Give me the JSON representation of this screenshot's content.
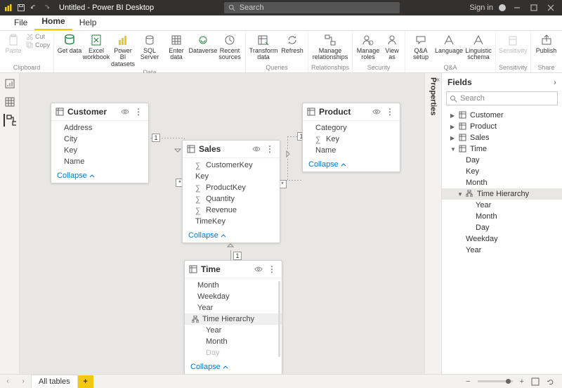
{
  "titlebar": {
    "title": "Untitled - Power BI Desktop",
    "search_placeholder": "Search",
    "signin": "Sign in"
  },
  "menu": {
    "file": "File",
    "home": "Home",
    "help": "Help"
  },
  "ribbon": {
    "clipboard": {
      "label": "Clipboard",
      "paste": "Paste",
      "cut": "Cut",
      "copy": "Copy"
    },
    "data": {
      "label": "Data",
      "get": "Get data",
      "excel": "Excel workbook",
      "pbids": "Power BI datasets",
      "sql": "SQL Server",
      "enter": "Enter data",
      "dataverse": "Dataverse",
      "recent": "Recent sources"
    },
    "queries": {
      "label": "Queries",
      "transform": "Transform data",
      "refresh": "Refresh"
    },
    "relationships": {
      "label": "Relationships",
      "manage": "Manage relationships"
    },
    "security": {
      "label": "Security",
      "roles": "Manage roles",
      "view": "View as"
    },
    "qa": {
      "label": "Q&A",
      "setup": "Q&A setup",
      "lang": "Language",
      "schema": "Linguistic schema"
    },
    "sensitivity": {
      "label": "Sensitivity",
      "btn": "Sensitivity"
    },
    "share": {
      "label": "Share",
      "publish": "Publish"
    }
  },
  "tables": {
    "customer": {
      "title": "Customer",
      "fields": [
        "Address",
        "City",
        "Key",
        "Name"
      ],
      "collapse": "Collapse"
    },
    "sales": {
      "title": "Sales",
      "fields": [
        "CustomerKey",
        "Key",
        "ProductKey",
        "Quantity",
        "Revenue",
        "TimeKey"
      ],
      "collapse": "Collapse"
    },
    "product": {
      "title": "Product",
      "fields": [
        "Category",
        "Key",
        "Name"
      ],
      "collapse": "Collapse"
    },
    "time": {
      "title": "Time",
      "fields": [
        "Month",
        "Weekday",
        "Year"
      ],
      "hier": "Time Hierarchy",
      "hfields": [
        "Year",
        "Month",
        "Day"
      ],
      "collapse": "Collapse"
    }
  },
  "badges": {
    "one": "1",
    "many": "*"
  },
  "properties": "Properties",
  "fields": {
    "title": "Fields",
    "search": "Search",
    "customer": "Customer",
    "product": "Product",
    "sales": "Sales",
    "time": "Time",
    "day": "Day",
    "key": "Key",
    "month": "Month",
    "hier": "Time Hierarchy",
    "year": "Year",
    "weekday": "Weekday"
  },
  "status": {
    "alltables": "All tables"
  }
}
